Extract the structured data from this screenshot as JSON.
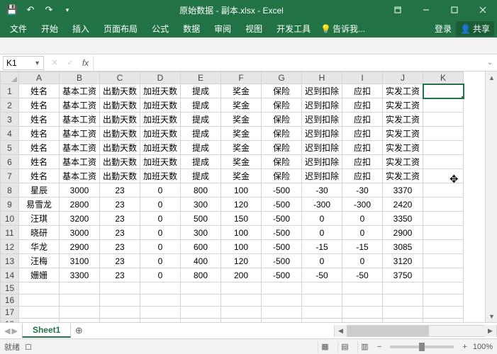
{
  "titlebar": {
    "title": "原始数据 - 副本.xlsx - Excel"
  },
  "ribbon": {
    "tabs": [
      "文件",
      "开始",
      "插入",
      "页面布局",
      "公式",
      "数据",
      "审阅",
      "视图",
      "开发工具"
    ],
    "tell": "告诉我...",
    "signin": "登录",
    "share": "共享"
  },
  "formula": {
    "namebox": "K1",
    "fx": "fx",
    "value": ""
  },
  "grid": {
    "cols": [
      "A",
      "B",
      "C",
      "D",
      "E",
      "F",
      "G",
      "H",
      "I",
      "J",
      "K"
    ],
    "rowCount": 18,
    "headerRow": [
      "姓名",
      "基本工资",
      "出勤天数",
      "加班天数",
      "提成",
      "奖金",
      "保险",
      "迟到扣除",
      "应扣",
      "实发工资",
      ""
    ],
    "headerRepeat": 7,
    "dataRows": [
      {
        "r": 8,
        "cells": [
          "星辰",
          "3000",
          "23",
          "0",
          "800",
          "100",
          "-500",
          "-30",
          "-30",
          "3370",
          ""
        ]
      },
      {
        "r": 9,
        "cells": [
          "易雪龙",
          "2800",
          "23",
          "0",
          "300",
          "120",
          "-500",
          "-300",
          "-300",
          "2420",
          ""
        ]
      },
      {
        "r": 10,
        "cells": [
          "汪琪",
          "3200",
          "23",
          "0",
          "500",
          "150",
          "-500",
          "0",
          "0",
          "3350",
          ""
        ]
      },
      {
        "r": 11,
        "cells": [
          "晓研",
          "3000",
          "23",
          "0",
          "300",
          "100",
          "-500",
          "0",
          "0",
          "2900",
          ""
        ]
      },
      {
        "r": 12,
        "cells": [
          "华龙",
          "2900",
          "23",
          "0",
          "600",
          "100",
          "-500",
          "-15",
          "-15",
          "3085",
          ""
        ]
      },
      {
        "r": 13,
        "cells": [
          "汪梅",
          "3100",
          "23",
          "0",
          "400",
          "120",
          "-500",
          "0",
          "0",
          "3120",
          ""
        ]
      },
      {
        "r": 14,
        "cells": [
          "姗姗",
          "3300",
          "23",
          "0",
          "800",
          "200",
          "-500",
          "-50",
          "-50",
          "3750",
          ""
        ]
      }
    ],
    "selected": {
      "row": 1,
      "col": "K"
    }
  },
  "sheet": {
    "name": "Sheet1"
  },
  "status": {
    "ready": "就绪",
    "zoom": "100%"
  },
  "chart_data": {
    "type": "table",
    "columns": [
      "姓名",
      "基本工资",
      "出勤天数",
      "加班天数",
      "提成",
      "奖金",
      "保险",
      "迟到扣除",
      "应扣",
      "实发工资"
    ],
    "rows": [
      [
        "星辰",
        3000,
        23,
        0,
        800,
        100,
        -500,
        -30,
        -30,
        3370
      ],
      [
        "易雪龙",
        2800,
        23,
        0,
        300,
        120,
        -500,
        -300,
        -300,
        2420
      ],
      [
        "汪琪",
        3200,
        23,
        0,
        500,
        150,
        -500,
        0,
        0,
        3350
      ],
      [
        "晓研",
        3000,
        23,
        0,
        300,
        100,
        -500,
        0,
        0,
        2900
      ],
      [
        "华龙",
        2900,
        23,
        0,
        600,
        100,
        -500,
        -15,
        -15,
        3085
      ],
      [
        "汪梅",
        3100,
        23,
        0,
        400,
        120,
        -500,
        0,
        0,
        3120
      ],
      [
        "姗姗",
        3300,
        23,
        0,
        800,
        200,
        -500,
        -50,
        -50,
        3750
      ]
    ]
  }
}
